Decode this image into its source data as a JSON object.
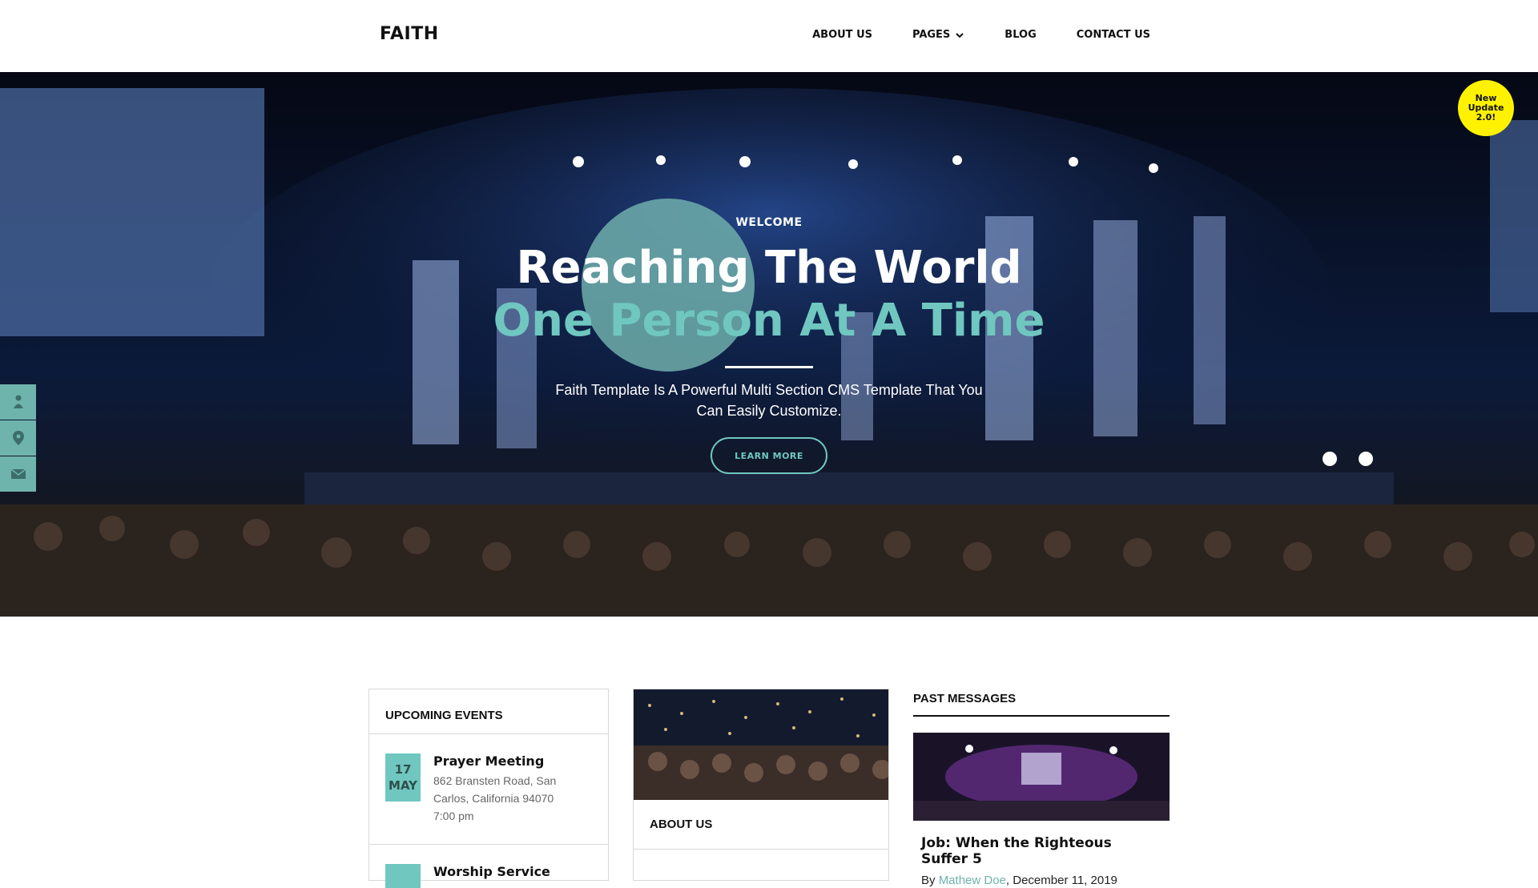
{
  "header": {
    "logo": "FAITH",
    "nav": [
      {
        "label": "ABOUT US"
      },
      {
        "label": "PAGES",
        "has_dropdown": true
      },
      {
        "label": "BLOG"
      },
      {
        "label": "CONTACT US"
      }
    ]
  },
  "hero": {
    "badge": "New Update 2.0!",
    "welcome": "WELCOME",
    "headline_line1": "Reaching The World",
    "headline_line2": "One Person At A Time",
    "subtitle": "Faith Template Is A Powerful Multi Section CMS Template That You Can Easily Customize.",
    "cta": "LEARN MORE"
  },
  "side_icons": [
    "person-icon",
    "map-pin-icon",
    "envelope-icon"
  ],
  "events": {
    "title": "UPCOMING EVENTS",
    "items": [
      {
        "day": "17",
        "month": "MAY",
        "name": "Prayer Meeting",
        "address": "862 Bransten Road, San Carlos, California 94070",
        "time": "7:00 pm"
      },
      {
        "day": "",
        "month": "",
        "name": "Worship Service",
        "address": "",
        "time": ""
      }
    ]
  },
  "about": {
    "title": "ABOUT US"
  },
  "past_messages": {
    "title": "PAST MESSAGES",
    "item": {
      "title": "Job: When the Righteous Suffer 5",
      "by_prefix": "By",
      "author": "Mathew Doe",
      "date": "December 11, 2019"
    }
  },
  "colors": {
    "accent": "#6fc7c0",
    "badge": "#fff200",
    "side_icons_bg": "#6fb3ad"
  }
}
